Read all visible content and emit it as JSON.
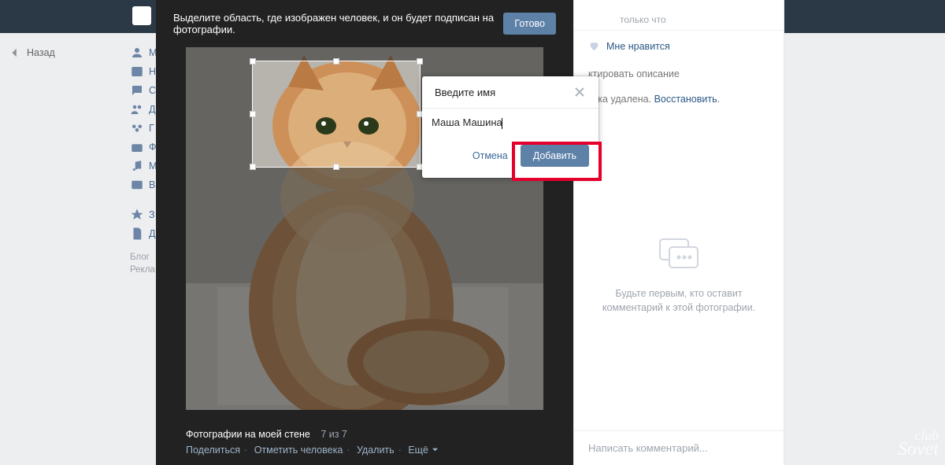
{
  "back_label": "Назад",
  "sidebar": {
    "items": [
      {
        "icon": "user",
        "label": "М"
      },
      {
        "icon": "news",
        "label": "Н"
      },
      {
        "icon": "msg",
        "label": "С"
      },
      {
        "icon": "friends",
        "label": "Д"
      },
      {
        "icon": "groups",
        "label": "Г"
      },
      {
        "icon": "photo",
        "label": "Ф"
      },
      {
        "icon": "music",
        "label": "М"
      },
      {
        "icon": "video",
        "label": "В"
      }
    ],
    "pin1": {
      "icon": "star",
      "label": "З"
    },
    "pin2": {
      "icon": "doc",
      "label": "Д"
    },
    "footer": [
      "Блог",
      "Рекла"
    ]
  },
  "photo": {
    "bar_text": "Выделите область, где изображен человек, и он будет подписан на фотографии.",
    "bar_button": "Готово",
    "album": "Фотографии на моей стене",
    "counter": "7 из 7",
    "actions": {
      "share": "Поделиться",
      "tag": "Отметить человека",
      "del": "Удалить",
      "more": "Ещё"
    }
  },
  "tag": {
    "title": "Введите имя",
    "value": "Маша Машина",
    "cancel": "Отмена",
    "add": "Добавить"
  },
  "right": {
    "when": "только что",
    "like": "Мне нравится",
    "edit_desc": "ктировать описание",
    "deleted_prefix": "етка удалена. ",
    "restore": "Восстановить",
    "empty1": "Будьте первым, кто оставит",
    "empty2": "комментарий к этой фотографии.",
    "write": "Написать комментарий..."
  },
  "watermark": {
    "a": "club",
    "b": "Sovet"
  }
}
